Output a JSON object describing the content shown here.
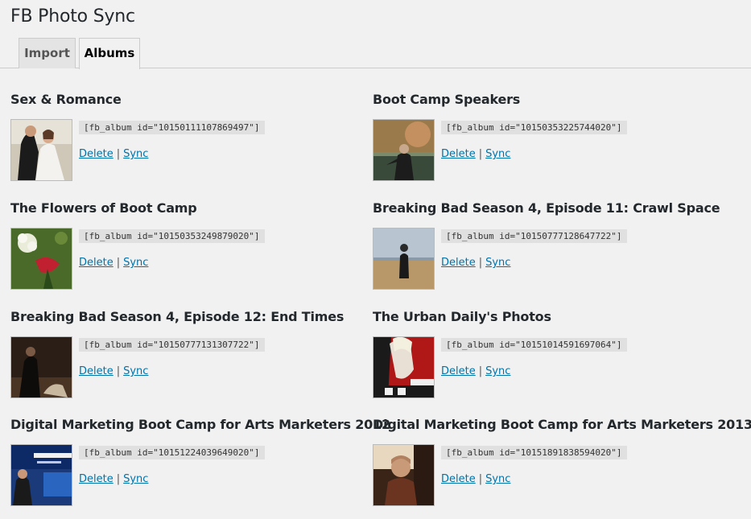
{
  "page": {
    "title": "FB Photo Sync"
  },
  "tabs": [
    {
      "label": "Import",
      "active": false
    },
    {
      "label": "Albums",
      "active": true
    }
  ],
  "albums": [
    {
      "title": "Sex & Romance",
      "shortcode": "[fb_album id=\"10150111107869497\"]",
      "thumb": "wedding-couple-photo"
    },
    {
      "title": "Boot Camp Speakers",
      "shortcode": "[fb_album id=\"10150353225744020\"]",
      "thumb": "speaker-photo"
    },
    {
      "title": "The Flowers of Boot Camp",
      "shortcode": "[fb_album id=\"10150353249879020\"]",
      "thumb": "flowers-photo"
    },
    {
      "title": "Breaking Bad Season 4, Episode 11: Crawl Space",
      "shortcode": "[fb_album id=\"10150777128647722\"]",
      "thumb": "desert-figure-photo"
    },
    {
      "title": "Breaking Bad Season 4, Episode 12: End Times",
      "shortcode": "[fb_album id=\"10150777131307722\"]",
      "thumb": "dark-scene-photo"
    },
    {
      "title": "The Urban Daily's Photos",
      "shortcode": "[fb_album id=\"10151014591697064\"]",
      "thumb": "poster-photo"
    },
    {
      "title": "Digital Marketing Boot Camp for Arts Marketers 2012",
      "shortcode": "[fb_album id=\"10151224039649020\"]",
      "thumb": "conference-photo"
    },
    {
      "title": "Digital Marketing Boot Camp for Arts Marketers 2013",
      "shortcode": "[fb_album id=\"10151891838594020\"]",
      "thumb": "presenter-photo"
    }
  ],
  "actions": {
    "delete_label": "Delete",
    "separator": "|",
    "sync_label": "Sync"
  }
}
